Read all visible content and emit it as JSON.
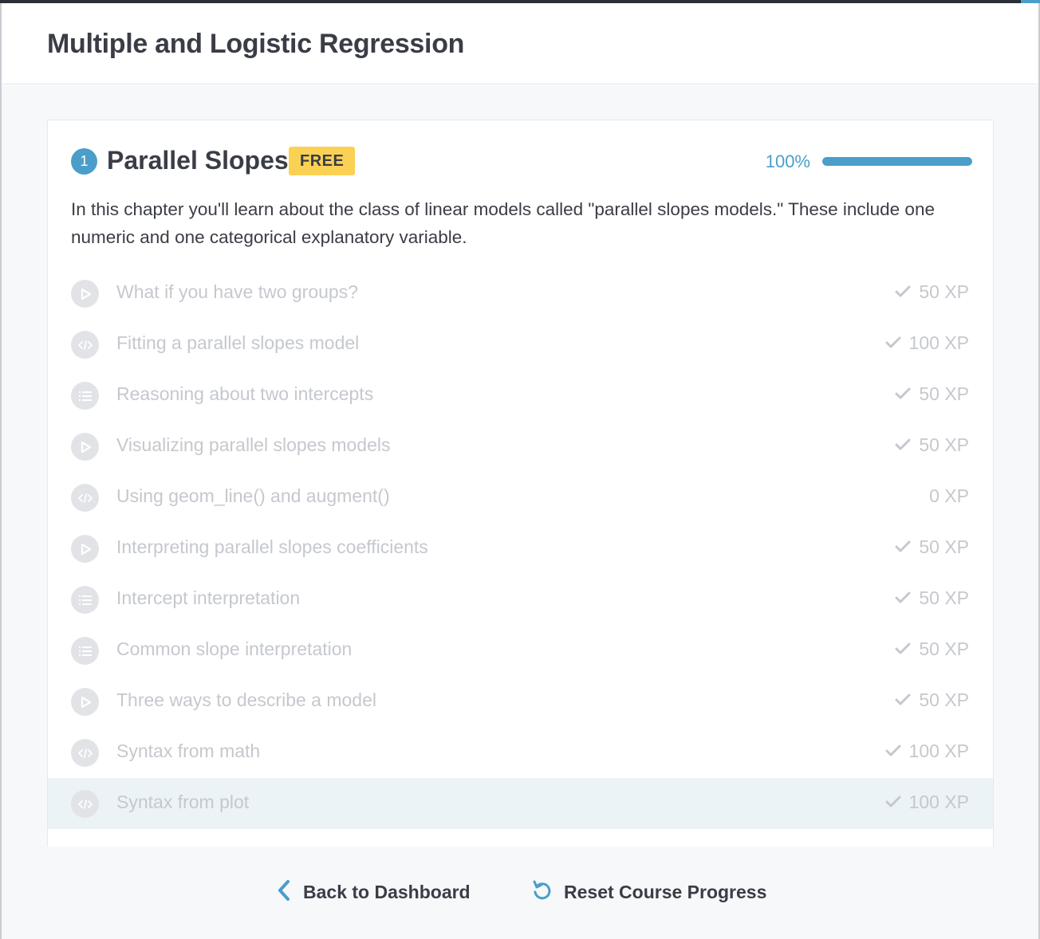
{
  "course": {
    "title": "Multiple and Logistic Regression"
  },
  "chapter": {
    "number": "1",
    "title": "Parallel Slopes",
    "badge": "FREE",
    "progress_label": "100%",
    "progress_fraction": 1.0,
    "description": "In this chapter you'll learn about the class of linear models called \"parallel slopes models.\" These include one numeric and one categorical explanatory variable."
  },
  "exercises": [
    {
      "type": "video",
      "icon": "play-icon",
      "title": "What if you have two groups?",
      "xp": "50 XP",
      "completed": true
    },
    {
      "type": "code",
      "icon": "code-icon",
      "title": "Fitting a parallel slopes model",
      "xp": "100 XP",
      "completed": true
    },
    {
      "type": "mc",
      "icon": "list-icon",
      "title": "Reasoning about two intercepts",
      "xp": "50 XP",
      "completed": true
    },
    {
      "type": "video",
      "icon": "play-icon",
      "title": "Visualizing parallel slopes models",
      "xp": "50 XP",
      "completed": true
    },
    {
      "type": "code",
      "icon": "code-icon",
      "title": "Using geom_line() and augment()",
      "xp": "0 XP",
      "completed": false
    },
    {
      "type": "video",
      "icon": "play-icon",
      "title": "Interpreting parallel slopes coefficients",
      "xp": "50 XP",
      "completed": true
    },
    {
      "type": "mc",
      "icon": "list-icon",
      "title": "Intercept interpretation",
      "xp": "50 XP",
      "completed": true
    },
    {
      "type": "mc",
      "icon": "list-icon",
      "title": "Common slope interpretation",
      "xp": "50 XP",
      "completed": true
    },
    {
      "type": "video",
      "icon": "play-icon",
      "title": "Three ways to describe a model",
      "xp": "50 XP",
      "completed": true
    },
    {
      "type": "code",
      "icon": "code-icon",
      "title": "Syntax from math",
      "xp": "100 XP",
      "completed": true
    },
    {
      "type": "code",
      "icon": "code-icon",
      "title": "Syntax from plot",
      "xp": "100 XP",
      "completed": true,
      "highlighted": true
    }
  ],
  "footer": {
    "back_label": "Back to Dashboard",
    "reset_label": "Reset Course Progress"
  },
  "colors": {
    "accent": "#4a9ec9",
    "badge": "#fbd153",
    "text": "#3a3d46",
    "muted": "#c5c8ce"
  }
}
